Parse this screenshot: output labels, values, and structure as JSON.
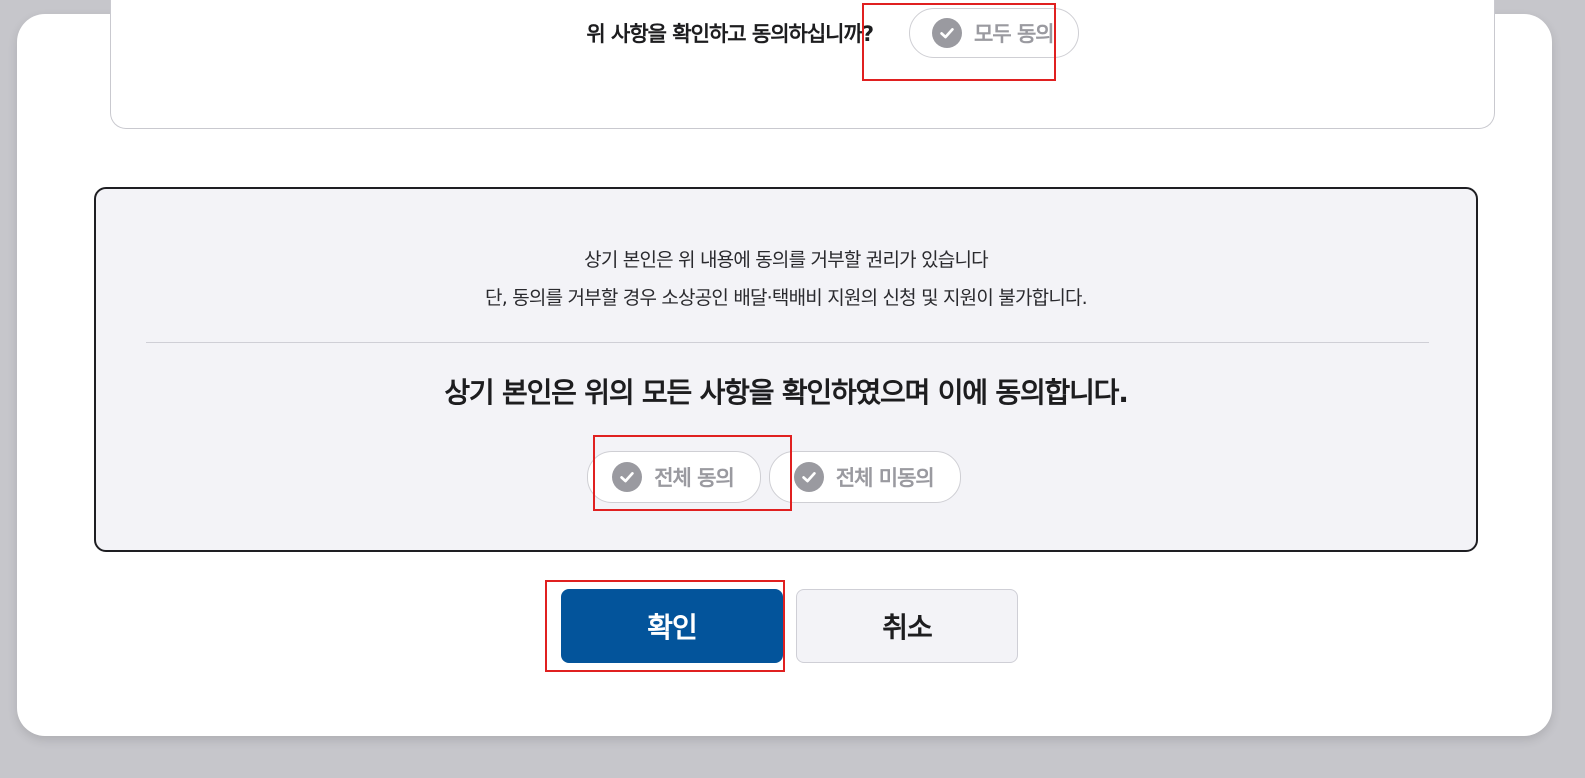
{
  "top_section": {
    "question": "위 사항을 확인하고 동의하십니까?",
    "agree_all_label": "모두 동의"
  },
  "consent_section": {
    "notice_line1": "상기 본인은 위 내용에 동의를 거부할 권리가 있습니다",
    "notice_line2": "단, 동의를 거부할 경우 소상공인 배달·택배비 지원의 신청 및 지원이 불가합니다.",
    "statement": "상기 본인은 위의 모든 사항을 확인하였으며 이에 동의합니다.",
    "agree_all_label": "전체 동의",
    "disagree_all_label": "전체 미동의"
  },
  "actions": {
    "confirm_label": "확인",
    "cancel_label": "취소"
  },
  "colors": {
    "primary": "#03549b",
    "highlight": "#e02020",
    "unchecked_grey": "#9a9aa0",
    "panel_bg": "#f3f3f7"
  },
  "icons": [
    "check-circle-icon"
  ]
}
